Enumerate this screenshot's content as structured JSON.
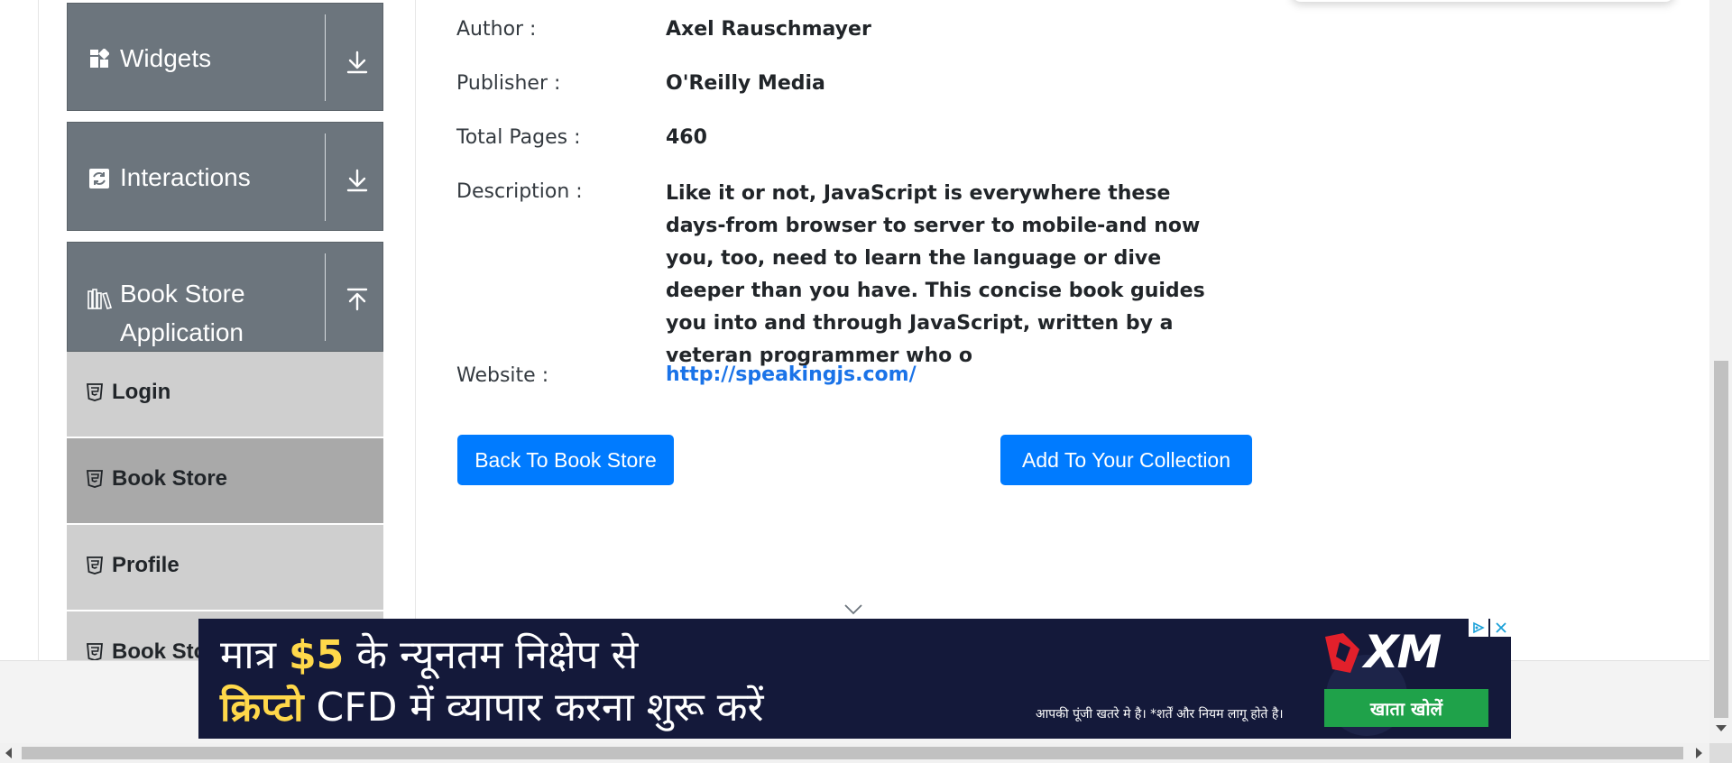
{
  "sidebar": {
    "groups": [
      {
        "title": "Widgets",
        "icon": "widgets-icon",
        "arrow": "download-arrow-icon"
      },
      {
        "title": "Interactions",
        "icon": "interactions-icon",
        "arrow": "download-arrow-icon"
      },
      {
        "title_line1": "Book Store",
        "title_line2": "Application",
        "icon": "books-icon",
        "arrow": "upload-arrow-icon"
      }
    ],
    "items": [
      {
        "label": "Login",
        "active": false
      },
      {
        "label": "Book Store",
        "active": true
      },
      {
        "label": "Profile",
        "active": false
      },
      {
        "label": "Book Sto",
        "active": false
      }
    ]
  },
  "book": {
    "author_label": "Author :",
    "author": "Axel Rauschmayer",
    "publisher_label": "Publisher :",
    "publisher": "O'Reilly Media",
    "pages_label": "Total Pages :",
    "pages": "460",
    "description_label": "Description :",
    "description": "Like it or not, JavaScript is everywhere these days-from browser to server to mobile-and now you, too, need to learn the language or dive deeper than you have. This concise book guides you into and through JavaScript, written by a veteran programmer who o",
    "website_label": "Website :",
    "website": "http://speakingjs.com/"
  },
  "actions": {
    "back_label": "Back To Book Store",
    "add_label": "Add To Your Collection"
  },
  "ad": {
    "line1_pre": "मात्र ",
    "line1_amount": "$5",
    "line1_post": " के न्यूनतम निक्षेप से",
    "line2_highlight": "क्रिप्टो",
    "line2_post": " CFD में  व्यापार करना शुरू करें",
    "brand": "XM",
    "disclaimer": "आपकी पूंजी खतरे मे है। *शर्तें और नियम लागू होते है।",
    "cta_label": "खाता खोलें",
    "colors": {
      "background": "#14193a",
      "accent": "#ffd84a",
      "cta": "#1fa24a",
      "brand_red": "#e2202b"
    }
  },
  "colors": {
    "sidebar_header": "#6c757d",
    "menu_item": "#cfcfcf",
    "menu_item_active": "#a9a9a9",
    "primary": "#007bff",
    "link": "#1a73e8"
  }
}
